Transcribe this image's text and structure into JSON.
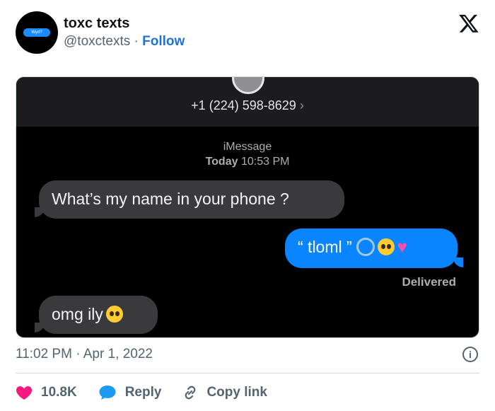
{
  "tweet": {
    "author_name": "toxc texts",
    "handle": "@toxctexts",
    "separator": " · ",
    "follow_label": "Follow",
    "avatar_text": "Wyd?",
    "timestamp": "11:02 PM · Apr 1, 2022",
    "info_label": "i",
    "like_count": "10.8K",
    "reply_label": "Reply",
    "copy_link_label": "Copy link",
    "icons": [
      "x-logo-icon",
      "heart-icon",
      "reply-icon",
      "link-icon",
      "info-icon"
    ]
  },
  "screenshot": {
    "phone_number": "+1 (224) 598-8629",
    "chevron": "›",
    "service": "iMessage",
    "day": "Today",
    "time": "10:53 PM",
    "messages": [
      {
        "direction": "received",
        "text": "What’s my name in your phone ?"
      },
      {
        "direction": "sent",
        "text": "“ tloml ”",
        "emojis": [
          "ring",
          "pleading-face",
          "sparkling-heart"
        ]
      },
      {
        "direction": "received",
        "text": "omg ily",
        "emojis": [
          "pleading-face"
        ]
      }
    ],
    "status": "Delivered"
  },
  "colors": {
    "follow": "#1d74d6",
    "heart": "#f91880",
    "reply": "#1d9bf0",
    "sent_bubble": "#0a84ff",
    "received_bubble": "#3a3a3c"
  }
}
